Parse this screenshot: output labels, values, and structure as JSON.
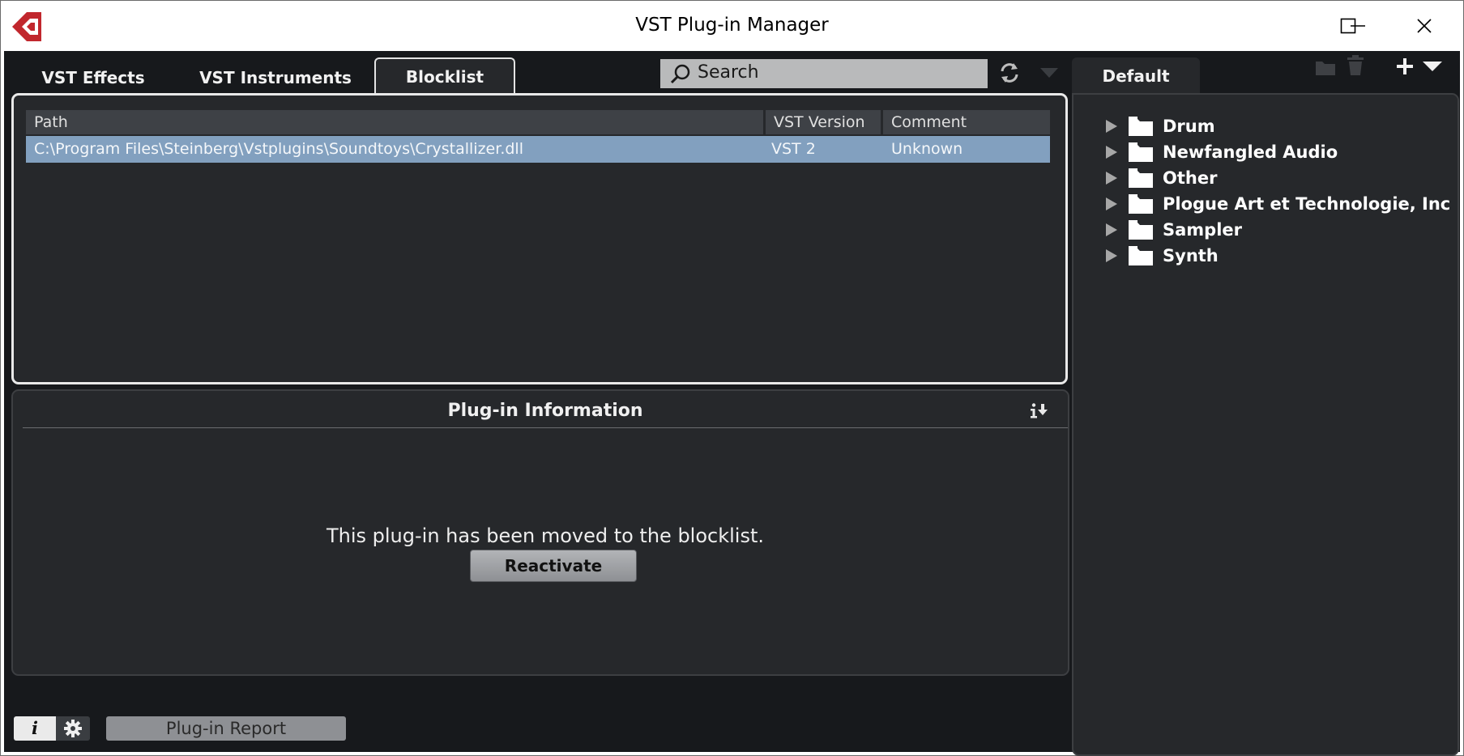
{
  "window": {
    "title": "VST Plug-in Manager"
  },
  "tabs": [
    {
      "label": "VST Effects",
      "active": false
    },
    {
      "label": "VST Instruments",
      "active": false
    },
    {
      "label": "Blocklist",
      "active": true
    }
  ],
  "search": {
    "placeholder": "Search"
  },
  "table": {
    "columns": [
      "Path",
      "VST Version",
      "Comment"
    ],
    "rows": [
      {
        "path": "C:\\Program Files\\Steinberg\\Vstplugins\\Soundtoys\\Crystallizer.dll",
        "version": "VST 2",
        "comment": "Unknown",
        "selected": true
      }
    ]
  },
  "info": {
    "title": "Plug-in Information",
    "message": "This plug-in has been moved to the blocklist.",
    "button": "Reactivate"
  },
  "collection": {
    "tab": "Default",
    "folders": [
      "Drum",
      "Newfangled Audio",
      "Other",
      "Plogue Art et Technologie, Inc",
      "Sampler",
      "Synth"
    ]
  },
  "footer": {
    "info_label": "i",
    "report_label": "Plug-in Report"
  },
  "colors": {
    "accent_selection": "#82a0bf",
    "brand_red": "#c1272d",
    "panel_bg": "#26282b"
  }
}
